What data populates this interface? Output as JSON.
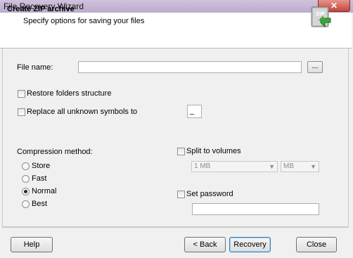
{
  "window": {
    "title": "File Recovery Wizard",
    "close_glyph": "✕"
  },
  "header": {
    "title": "Create ZIP archive",
    "subtitle": "Specify options for saving your files",
    "icon": "zip-archive-icon",
    "icon_text": "ZIP"
  },
  "file_name": {
    "label": "File name:",
    "value": "",
    "browse_label": "..."
  },
  "restore_folders": {
    "label": "Restore folders structure",
    "checked": false
  },
  "replace_unknown": {
    "label": "Replace all unknown symbols to",
    "value": "_",
    "checked": false
  },
  "compression": {
    "label": "Compression method:",
    "options": [
      "Store",
      "Fast",
      "Normal",
      "Best"
    ],
    "selected": "Normal"
  },
  "split": {
    "label": "Split to volumes",
    "checked": false,
    "size_value": "1 MB",
    "unit_value": "MB"
  },
  "password": {
    "label": "Set password",
    "checked": false,
    "value": ""
  },
  "footer": {
    "help": "Help",
    "back": "< Back",
    "recovery": "Recovery",
    "close": "Close"
  },
  "colors": {
    "accent_border": "#3c7fb1",
    "title_bar": "#bcabcd",
    "close_button": "#c5463c"
  }
}
